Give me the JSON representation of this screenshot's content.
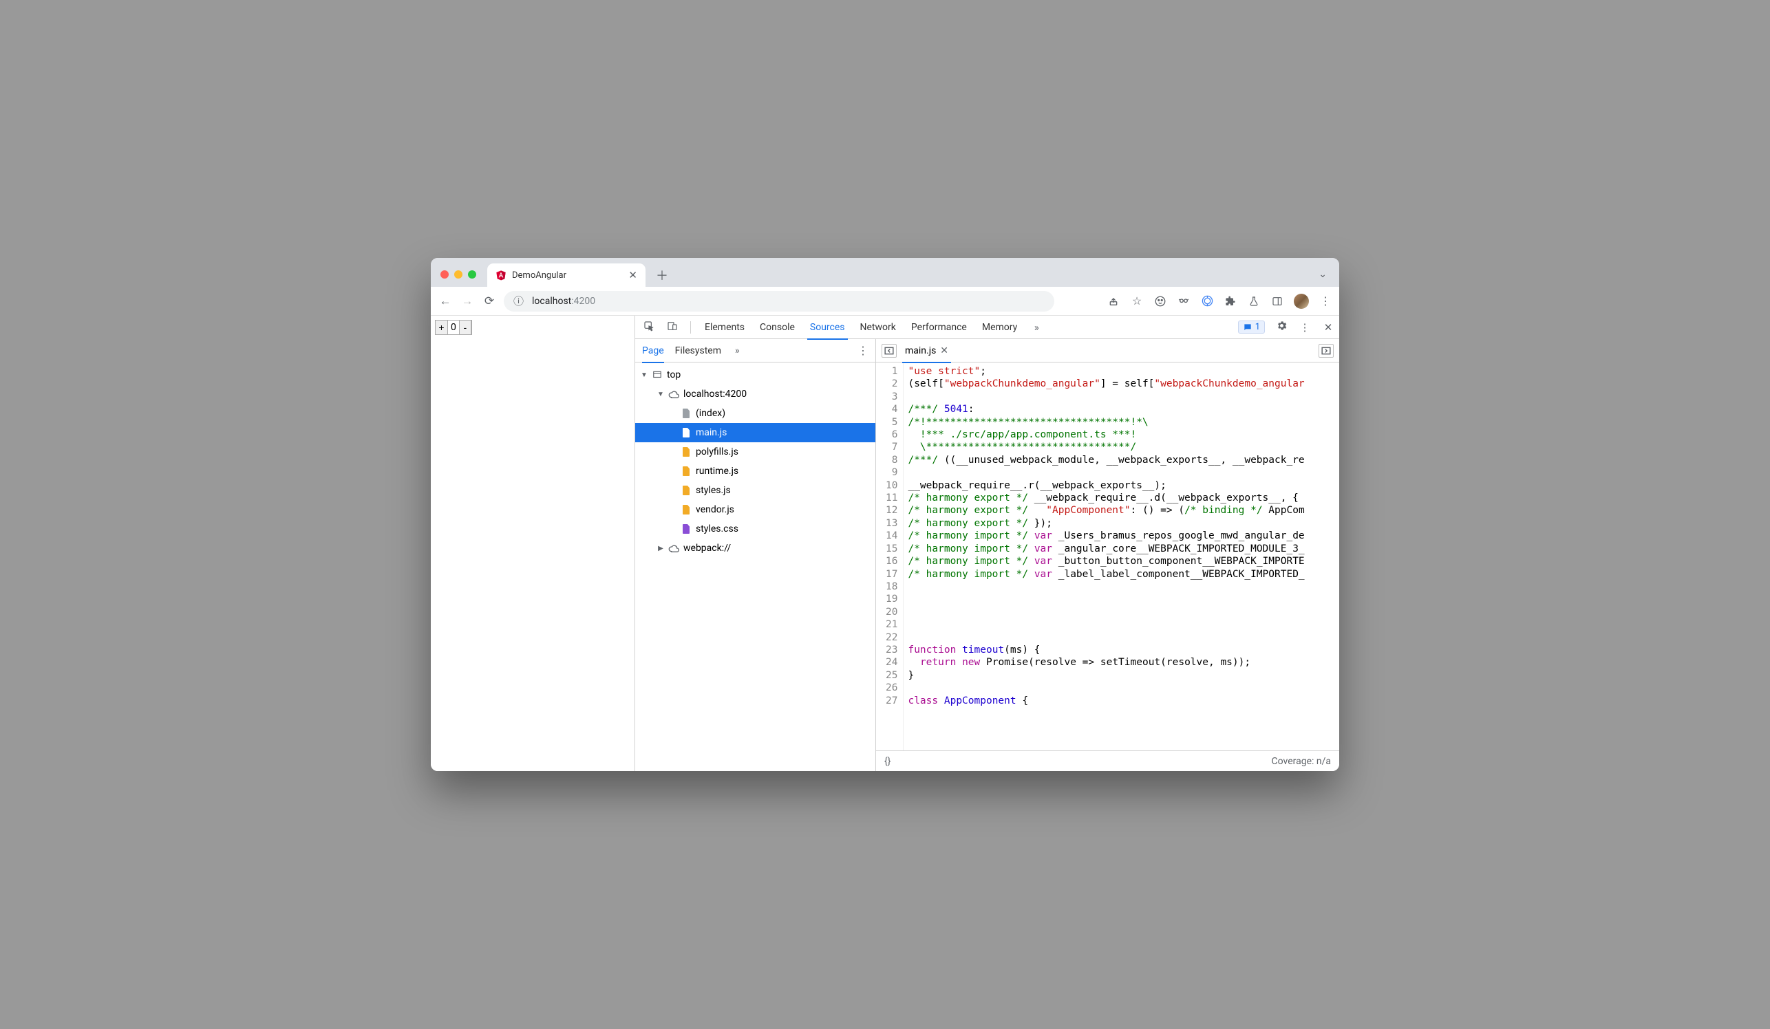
{
  "browser": {
    "tab_title": "DemoAngular",
    "url_display_host": "localhost",
    "url_display_port": ":4200"
  },
  "page": {
    "counter_value": "0"
  },
  "devtools": {
    "tabs": [
      "Elements",
      "Console",
      "Sources",
      "Network",
      "Performance",
      "Memory"
    ],
    "active_tab": "Sources",
    "issues_count": "1",
    "navigator": {
      "tabs": [
        "Page",
        "Filesystem"
      ],
      "active": "Page",
      "tree": {
        "top": "top",
        "origin": "localhost:4200",
        "files": [
          "(index)",
          "main.js",
          "polyfills.js",
          "runtime.js",
          "styles.js",
          "vendor.js",
          "styles.css"
        ],
        "selected": "main.js",
        "other": "webpack://"
      }
    },
    "editor": {
      "open_file": "main.js",
      "lines": [
        {
          "n": 1,
          "html": "<span class='tok-str'>\"use strict\"</span>;"
        },
        {
          "n": 2,
          "html": "(self[<span class='tok-str'>\"webpackChunkdemo_angular\"</span>] = self[<span class='tok-str'>\"webpackChunkdemo_angular</span>"
        },
        {
          "n": 3,
          "html": ""
        },
        {
          "n": 4,
          "html": "<span class='tok-com'>/***/</span> <span class='tok-num'>5041</span>:"
        },
        {
          "n": 5,
          "html": "<span class='tok-com'>/*!**********************************!*\\</span>"
        },
        {
          "n": 6,
          "html": "<span class='tok-com'>  !*** ./src/app/app.component.ts ***!</span>"
        },
        {
          "n": 7,
          "html": "<span class='tok-com'>  \\**********************************/</span>"
        },
        {
          "n": 8,
          "html": "<span class='tok-com'>/***/</span> ((__unused_webpack_module, __webpack_exports__, __webpack_re"
        },
        {
          "n": 9,
          "html": ""
        },
        {
          "n": 10,
          "html": "__webpack_require__.r(__webpack_exports__);"
        },
        {
          "n": 11,
          "html": "<span class='tok-com'>/* harmony export */</span> __webpack_require__.d(__webpack_exports__, {"
        },
        {
          "n": 12,
          "html": "<span class='tok-com'>/* harmony export */</span>   <span class='tok-str'>\"AppComponent\"</span>: () =&gt; (<span class='tok-com'>/* binding */</span> AppCom"
        },
        {
          "n": 13,
          "html": "<span class='tok-com'>/* harmony export */</span> });"
        },
        {
          "n": 14,
          "html": "<span class='tok-com'>/* harmony import */</span> <span class='tok-kw'>var</span> _Users_bramus_repos_google_mwd_angular_de"
        },
        {
          "n": 15,
          "html": "<span class='tok-com'>/* harmony import */</span> <span class='tok-kw'>var</span> _angular_core__WEBPACK_IMPORTED_MODULE_3_"
        },
        {
          "n": 16,
          "html": "<span class='tok-com'>/* harmony import */</span> <span class='tok-kw'>var</span> _button_button_component__WEBPACK_IMPORTE"
        },
        {
          "n": 17,
          "html": "<span class='tok-com'>/* harmony import */</span> <span class='tok-kw'>var</span> _label_label_component__WEBPACK_IMPORTED_"
        },
        {
          "n": 18,
          "html": ""
        },
        {
          "n": 19,
          "html": ""
        },
        {
          "n": 20,
          "html": ""
        },
        {
          "n": 21,
          "html": ""
        },
        {
          "n": 22,
          "html": ""
        },
        {
          "n": 23,
          "html": "<span class='tok-kw'>function</span> <span class='tok-def'>timeout</span>(ms) {"
        },
        {
          "n": 24,
          "html": "  <span class='tok-kw'>return</span> <span class='tok-kw'>new</span> Promise(resolve =&gt; setTimeout(resolve, ms));"
        },
        {
          "n": 25,
          "html": "}"
        },
        {
          "n": 26,
          "html": ""
        },
        {
          "n": 27,
          "html": "<span class='tok-kw'>class</span> <span class='tok-def'>AppComponent</span> {"
        }
      ]
    },
    "statusbar": {
      "format_label": "{}",
      "coverage": "Coverage: n/a"
    }
  }
}
